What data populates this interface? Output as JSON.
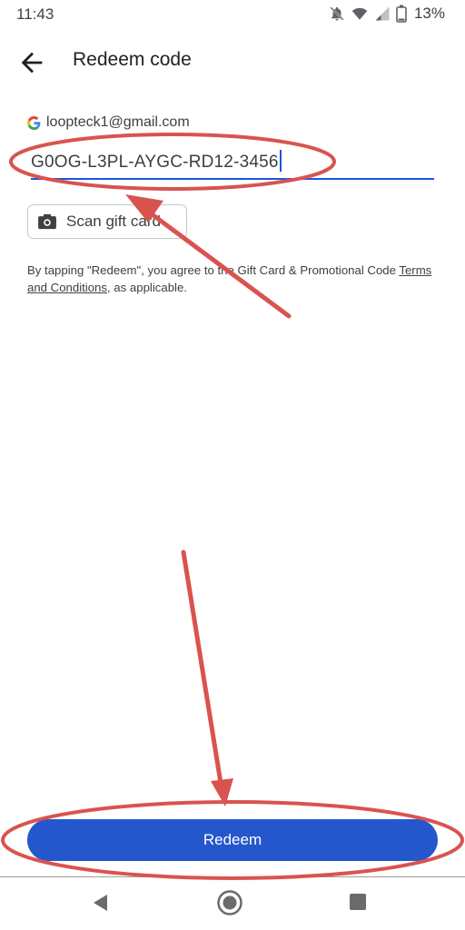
{
  "status_bar": {
    "time": "11:43",
    "battery_percent": "13%",
    "icons": [
      "mute-bell-icon",
      "wifi-icon",
      "signal-icon",
      "battery-icon"
    ]
  },
  "app_bar": {
    "title": "Redeem code",
    "back_icon": "arrow-back-icon"
  },
  "account": {
    "email": "loopteck1@gmail.com",
    "icon": "google-g-icon"
  },
  "code_input": {
    "value": "G0OG-L3PL-AYGC-RD12-3456"
  },
  "scan_button": {
    "label": "Scan gift card",
    "icon": "camera-icon"
  },
  "terms": {
    "text_before": "By tapping \"Redeem\", you agree to the Gift Card & Promotional Code ",
    "link": "Terms and Conditions",
    "text_after": ", as applicable."
  },
  "redeem_button": {
    "label": "Redeem"
  },
  "nav_bar": {
    "icons": [
      "nav-back-icon",
      "nav-home-icon",
      "nav-recents-icon"
    ]
  },
  "colors": {
    "accent": "#2557cc",
    "input_underline": "#1a56db",
    "annotation_red": "#d9534f"
  }
}
